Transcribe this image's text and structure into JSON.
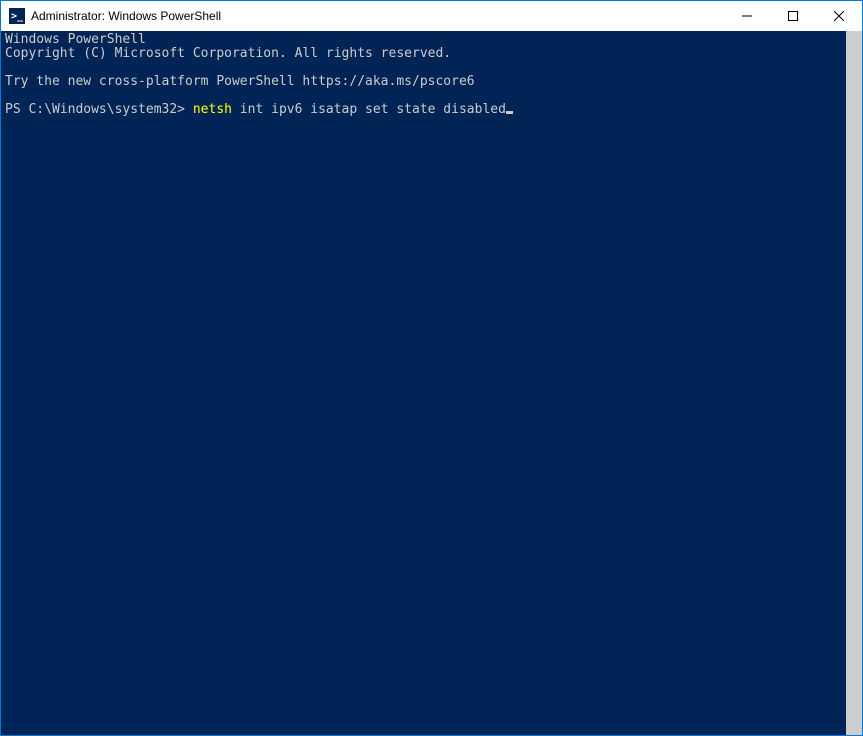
{
  "titlebar": {
    "icon_text": ">_",
    "title": "Administrator: Windows PowerShell"
  },
  "terminal": {
    "header_line1": "Windows PowerShell",
    "header_line2": "Copyright (C) Microsoft Corporation. All rights reserved.",
    "try_line": "Try the new cross-platform PowerShell https://aka.ms/pscore6",
    "prompt": "PS C:\\Windows\\system32> ",
    "command_highlight": "netsh",
    "command_rest": " int ipv6 isatap set state disabled"
  },
  "colors": {
    "bg": "#012456",
    "fg": "#cccccc",
    "highlight": "#ffff00",
    "border": "#0078d7"
  }
}
